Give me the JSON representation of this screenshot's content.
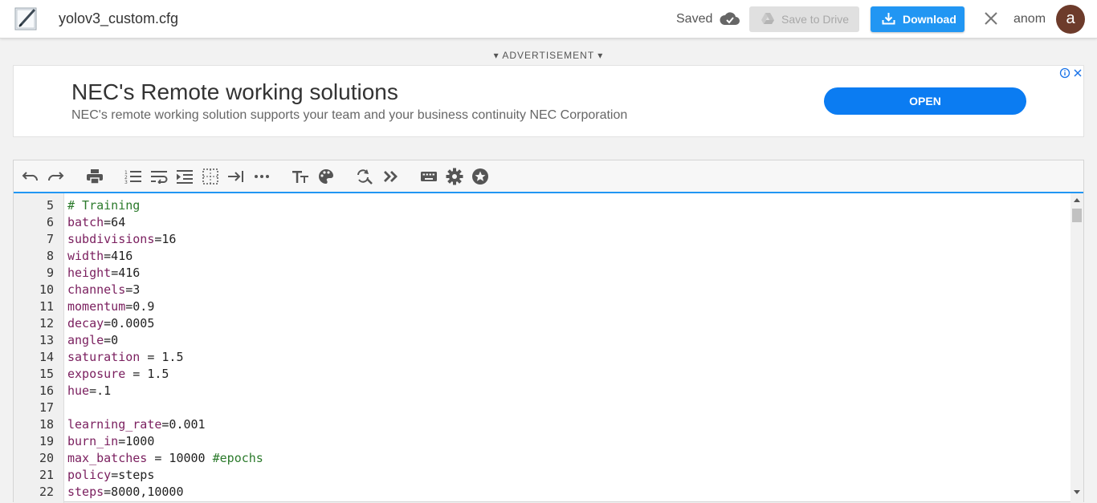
{
  "header": {
    "file_name": "yolov3_custom.cfg",
    "saved_label": "Saved",
    "save_to_drive_label": "Save to Drive",
    "download_label": "Download",
    "user_name": "anom",
    "avatar_letter": "a",
    "icons": [
      "app-logo-icon",
      "cloud-check-icon",
      "google-drive-icon",
      "download-icon",
      "close-icon"
    ]
  },
  "ad": {
    "label": "▾ ADVERTISEMENT ▾",
    "title": "NEC's Remote working solutions",
    "description": "NEC's remote working solution supports your team and your business continuity NEC Corporation",
    "cta": "OPEN"
  },
  "toolbar": {
    "icons": [
      "undo-icon",
      "redo-icon",
      "print-icon",
      "line-numbers-icon",
      "wrap-icon",
      "indent-icon",
      "whitespace-icon",
      "tab-icon",
      "more-icon",
      "font-size-icon",
      "theme-icon",
      "find-replace-icon",
      "expand-icon",
      "keyboard-icon",
      "settings-icon",
      "star-icon"
    ]
  },
  "editor": {
    "lines": [
      {
        "num": "5",
        "key": "",
        "rest": "",
        "comment": "# Training"
      },
      {
        "num": "6",
        "key": "batch",
        "rest": "=64",
        "comment": ""
      },
      {
        "num": "7",
        "key": "subdivisions",
        "rest": "=16",
        "comment": ""
      },
      {
        "num": "8",
        "key": "width",
        "rest": "=416",
        "comment": ""
      },
      {
        "num": "9",
        "key": "height",
        "rest": "=416",
        "comment": ""
      },
      {
        "num": "10",
        "key": "channels",
        "rest": "=3",
        "comment": ""
      },
      {
        "num": "11",
        "key": "momentum",
        "rest": "=0.9",
        "comment": ""
      },
      {
        "num": "12",
        "key": "decay",
        "rest": "=0.0005",
        "comment": ""
      },
      {
        "num": "13",
        "key": "angle",
        "rest": "=0",
        "comment": ""
      },
      {
        "num": "14",
        "key": "saturation",
        "rest": " = 1.5",
        "comment": ""
      },
      {
        "num": "15",
        "key": "exposure",
        "rest": " = 1.5",
        "comment": ""
      },
      {
        "num": "16",
        "key": "hue",
        "rest": "=.1",
        "comment": ""
      },
      {
        "num": "17",
        "key": "",
        "rest": "",
        "comment": ""
      },
      {
        "num": "18",
        "key": "learning_rate",
        "rest": "=0.001",
        "comment": ""
      },
      {
        "num": "19",
        "key": "burn_in",
        "rest": "=1000",
        "comment": ""
      },
      {
        "num": "20",
        "key": "max_batches",
        "rest": " = 10000 ",
        "comment": "#epochs"
      },
      {
        "num": "21",
        "key": "policy",
        "rest": "=steps",
        "comment": ""
      },
      {
        "num": "22",
        "key": "steps",
        "rest": "=8000,10000",
        "comment": ""
      }
    ]
  },
  "colors": {
    "accent": "#2196f3",
    "key_color": "#7a1e5e",
    "comment_color": "#2b7a2b",
    "avatar_bg": "#6d3b2b",
    "ad_button": "#0b7cf2"
  }
}
